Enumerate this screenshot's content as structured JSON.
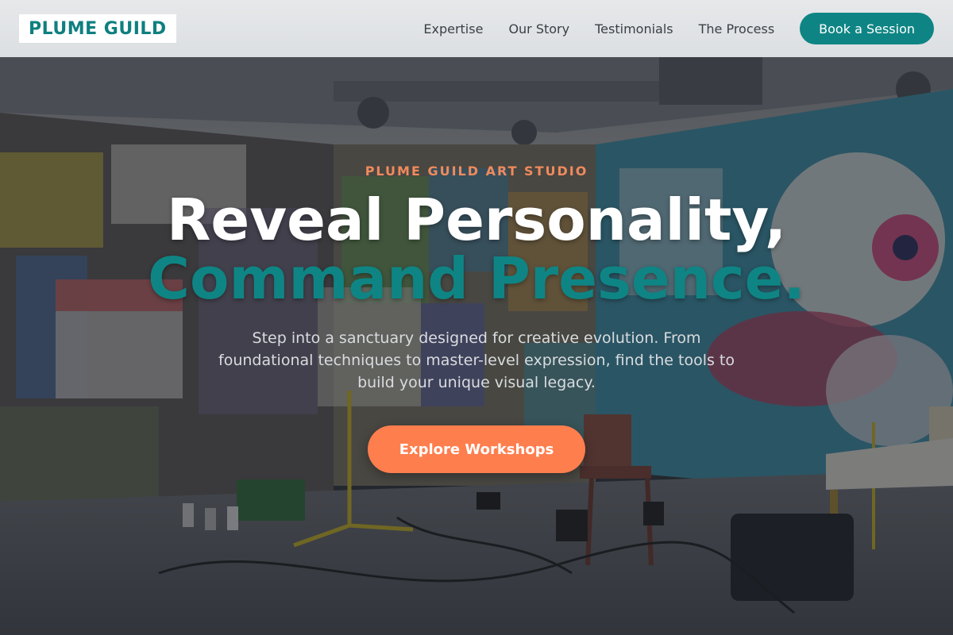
{
  "brand": {
    "logo_text": "PLUME GUILD",
    "logo_color": "#0e7f7f"
  },
  "nav": {
    "links": [
      "Expertise",
      "Our Story",
      "Testimonials",
      "The Process"
    ],
    "cta_label": "Book a Session",
    "cta_color": "#0e8584"
  },
  "hero": {
    "eyebrow": "PLUME GUILD ART STUDIO",
    "eyebrow_color": "#f08a5d",
    "headline_line1": "Reveal Personality,",
    "headline_line2": "Command Presence.",
    "headline_line2_color": "#0e8584",
    "subtext": "Step into a sanctuary designed for creative evolution. From foundational techniques to master-level expression, find the tools to build your unique visual legacy.",
    "cta_label": "Explore Workshops",
    "cta_color": "#ff7e4e",
    "background_image": "graffiti-art-studio-photo"
  }
}
